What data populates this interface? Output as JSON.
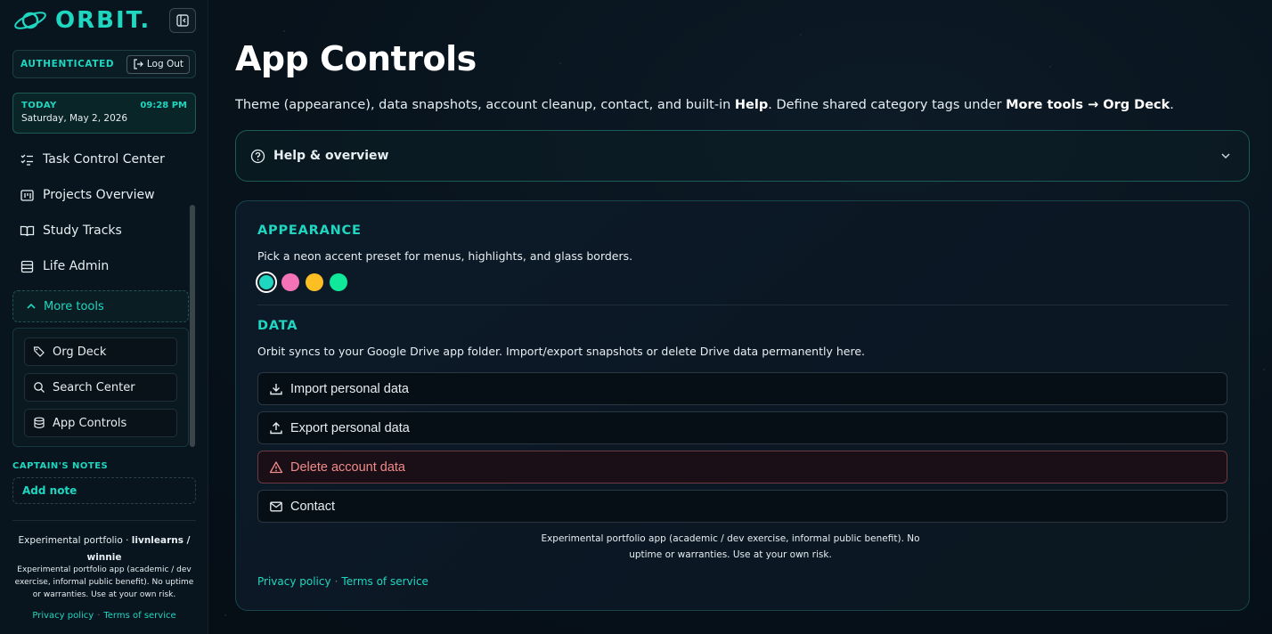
{
  "brand": {
    "name": "ORBIT."
  },
  "auth": {
    "status": "AUTHENTICATED",
    "logout_label": "Log Out"
  },
  "today": {
    "label": "TODAY",
    "time": "09:28 PM",
    "date": "Saturday, May 2, 2026"
  },
  "nav": {
    "items": [
      {
        "label": "Task Control Center",
        "icon": "list-check-icon"
      },
      {
        "label": "Projects Overview",
        "icon": "kanban-icon"
      },
      {
        "label": "Study Tracks",
        "icon": "book-open-icon"
      },
      {
        "label": "Life Admin",
        "icon": "stack-icon"
      }
    ],
    "more_tools_label": "More tools",
    "sub_items": [
      {
        "label": "Org Deck",
        "icon": "tags-icon"
      },
      {
        "label": "Search Center",
        "icon": "search-icon"
      },
      {
        "label": "App Controls",
        "icon": "database-icon"
      }
    ]
  },
  "notes": {
    "label": "CAPTAIN'S NOTES",
    "add_label": "Add note"
  },
  "sidebar_footer": {
    "credit_prefix": "Experimental portfolio · ",
    "credit_name": "livnlearns / winnie",
    "disclaimer": "Experimental portfolio app (academic / dev exercise, informal public benefit). No uptime or warranties. Use at your own risk.",
    "privacy": "Privacy policy",
    "terms": "Terms of service",
    "separator": "·"
  },
  "page": {
    "title": "App Controls",
    "desc_1": "Theme (appearance), data snapshots, account cleanup, contact, and built-in ",
    "desc_help": "Help",
    "desc_2": ". Define shared category tags under ",
    "desc_more": "More tools",
    "desc_arrow": " → ",
    "desc_org": "Org Deck",
    "desc_3": "."
  },
  "help": {
    "title": "Help & overview"
  },
  "appearance": {
    "heading": "APPEARANCE",
    "desc": "Pick a neon accent preset for menus, highlights, and glass borders.",
    "swatches": [
      "#1fd6c0",
      "#f472b6",
      "#fbbf24",
      "#10e89a"
    ],
    "selected_index": 0
  },
  "data_section": {
    "heading": "DATA",
    "desc": "Orbit syncs to your Google Drive app folder. Import/export snapshots or delete Drive data permanently here.",
    "import_label": "Import personal data",
    "export_label": "Export personal data",
    "delete_label": "Delete account data",
    "contact_label": "Contact"
  },
  "card_footer": {
    "disclaimer": "Experimental portfolio app (academic / dev exercise, informal public benefit). No uptime or warranties. Use at your own risk.",
    "privacy": "Privacy policy",
    "terms": "Terms of service",
    "separator": "·"
  },
  "colors": {
    "accent": "#1fd6c0",
    "danger": "#f18a8a",
    "background": "#07111a"
  }
}
